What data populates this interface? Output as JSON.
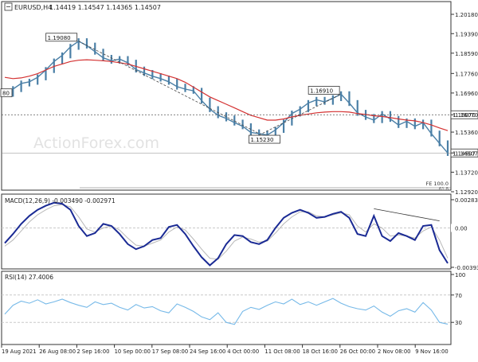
{
  "header": {
    "symbol": "EURUSD,H4",
    "ohlc": "1.14419 1.14547 1.14365 1.14507"
  },
  "watermark": "ActionForex.com",
  "colors": {
    "candle": "#4a7fa6",
    "ma": "#d43131",
    "macd": "#1a2a94",
    "signal": "#b8b8b8",
    "rsi": "#76b9e8",
    "grid_dash": "#c9c9c9",
    "axis": "#333333"
  },
  "chart_data": [
    {
      "type": "line",
      "title": "EURUSD,H4",
      "y_ticks": [
        "1.20180",
        "1.19390",
        "1.18590",
        "1.17760",
        "1.16960",
        "1.16070",
        "1.15360",
        "1.14507",
        "1.13720",
        "1.12920"
      ],
      "ylim": [
        1.1292,
        1.2018
      ],
      "x_ticks": [
        "19 Aug 2021",
        "26 Aug 08:00",
        "2 Sep 16:00",
        "10 Sep 00:00",
        "17 Sep 08:00",
        "24 Sep 16:00",
        "4 Oct 00:00",
        "11 Oct 08:00",
        "18 Oct 16:00",
        "26 Oct 00:00",
        "2 Nov 08:00",
        "9 Nov 16:00"
      ],
      "series": [
        {
          "values": [
            1.1693,
            1.1712,
            1.1735,
            1.1742,
            1.176,
            1.179,
            1.1825,
            1.185,
            1.1885,
            1.1908,
            1.189,
            1.1865,
            1.184,
            1.1828,
            1.1835,
            1.182,
            1.1792,
            1.1778,
            1.1765,
            1.1755,
            1.1742,
            1.1722,
            1.1712,
            1.1705,
            1.1665,
            1.163,
            1.1605,
            1.1592,
            1.1575,
            1.156,
            1.1535,
            1.153,
            1.1524,
            1.1545,
            1.1575,
            1.1612,
            1.163,
            1.1655,
            1.1668,
            1.166,
            1.1675,
            1.1691,
            1.1655,
            1.1615,
            1.1598,
            1.1585,
            1.161,
            1.159,
            1.1565,
            1.158,
            1.156,
            1.1575,
            1.153,
            1.149,
            1.14507
          ]
        },
        {
          "name": "MA",
          "values": [
            1.176,
            1.1755,
            1.1758,
            1.1765,
            1.1775,
            1.179,
            1.1805,
            1.1815,
            1.1825,
            1.183,
            1.1832,
            1.183,
            1.1828,
            1.1825,
            1.182,
            1.1815,
            1.1805,
            1.1795,
            1.1785,
            1.1775,
            1.1765,
            1.1755,
            1.174,
            1.172,
            1.17,
            1.168,
            1.1665,
            1.165,
            1.1635,
            1.162,
            1.1605,
            1.1595,
            1.1585,
            1.1585,
            1.159,
            1.1598,
            1.1605,
            1.161,
            1.1615,
            1.1618,
            1.162,
            1.162,
            1.1618,
            1.1612,
            1.1608,
            1.1603,
            1.16,
            1.1595,
            1.159,
            1.1585,
            1.1582,
            1.1575,
            1.1565,
            1.1553,
            1.1542
          ]
        }
      ],
      "annotations": {
        "price_labels": [
          "1.19080",
          "1.16910",
          "1.15230",
          "1.16070",
          "1.14507"
        ],
        "left_cut_label": "80",
        "fe_label": "FE 100.0",
        "fe_sub": "61.8"
      }
    },
    {
      "type": "line",
      "title": "MACD(12,26,9) -0.003490 -0.002971",
      "y_ticks": [
        "0.00283",
        "0.00",
        "-0.003939"
      ],
      "ylim": [
        -0.0039,
        0.0028
      ],
      "series": [
        {
          "values": [
            -0.0015,
            -0.0006,
            0.0004,
            0.0012,
            0.0018,
            0.0022,
            0.0025,
            0.0024,
            0.0018,
            0.0002,
            -0.0008,
            -0.0005,
            0.0004,
            0.0002,
            -0.0006,
            -0.0016,
            -0.0021,
            -0.0018,
            -0.0012,
            -0.001,
            0.0001,
            0.0003,
            -0.0006,
            -0.0018,
            -0.0029,
            -0.0037,
            -0.003,
            -0.0016,
            -0.0007,
            -0.0008,
            -0.0014,
            -0.0016,
            -0.0012,
            0.0,
            0.001,
            0.0015,
            0.0018,
            0.0015,
            0.001,
            0.0011,
            0.0014,
            0.0016,
            0.001,
            -0.0006,
            -0.0008,
            0.0012,
            -0.0008,
            -0.0013,
            -0.0005,
            -0.0008,
            -0.0012,
            0.0002,
            0.0003,
            -0.0022,
            -0.0035
          ]
        },
        {
          "values": [
            -0.0018,
            -0.0012,
            -0.0003,
            0.0006,
            0.0013,
            0.0018,
            0.0022,
            0.0023,
            0.0021,
            0.0011,
            -0.0001,
            -0.0004,
            0.0,
            0.0002,
            -0.0002,
            -0.001,
            -0.0017,
            -0.0018,
            -0.0015,
            -0.0012,
            -0.0004,
            0.0001,
            -0.0002,
            -0.0011,
            -0.0021,
            -0.003,
            -0.0031,
            -0.0023,
            -0.0013,
            -0.0009,
            -0.0011,
            -0.0014,
            -0.0013,
            -0.0005,
            0.0004,
            0.0011,
            0.0016,
            0.0016,
            0.0012,
            0.0011,
            0.0013,
            0.0015,
            0.0013,
            0.0002,
            -0.0004,
            0.0004,
            0.0,
            -0.0008,
            -0.0007,
            -0.0008,
            -0.001,
            -0.0003,
            0.0001,
            -0.0012,
            -0.003
          ]
        }
      ],
      "zero_label": "0.00"
    },
    {
      "type": "line",
      "title": "RSI(14) 27.4006",
      "y_ticks": [
        "100",
        "70",
        "30",
        "0"
      ],
      "ylim": [
        0,
        100
      ],
      "series": [
        {
          "values": [
            42,
            55,
            61,
            58,
            63,
            57,
            60,
            64,
            59,
            55,
            52,
            60,
            56,
            58,
            52,
            48,
            56,
            51,
            53,
            47,
            44,
            57,
            52,
            46,
            38,
            34,
            44,
            30,
            27,
            46,
            52,
            49,
            55,
            60,
            57,
            64,
            56,
            60,
            55,
            60,
            65,
            58,
            53,
            50,
            48,
            54,
            45,
            39,
            47,
            50,
            45,
            59,
            48,
            30,
            27.4
          ]
        }
      ]
    }
  ]
}
